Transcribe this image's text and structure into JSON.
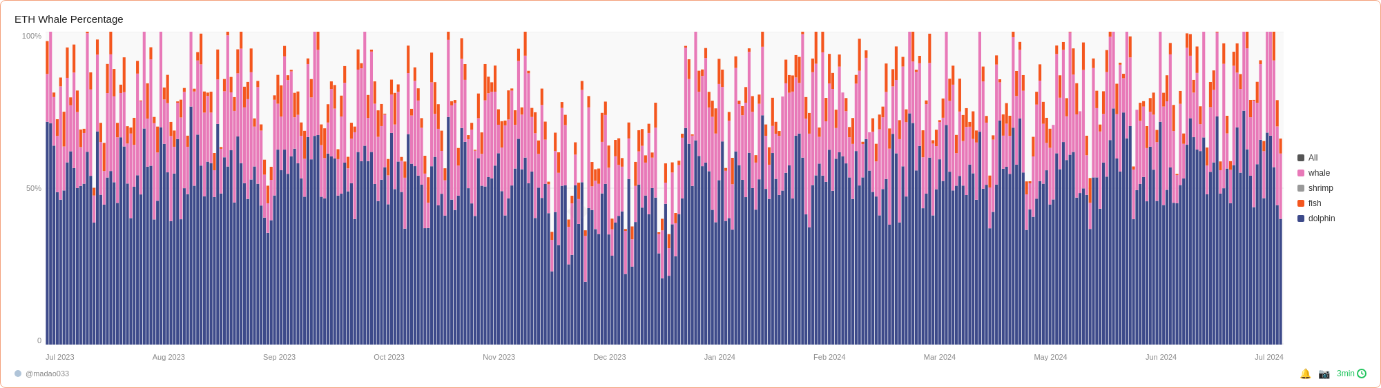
{
  "title": "ETH Whale Percentage",
  "y_axis": {
    "labels": [
      "100%",
      "50%",
      "0"
    ]
  },
  "x_axis": {
    "labels": [
      "Jul 2023",
      "Aug 2023",
      "Sep 2023",
      "Oct 2023",
      "Nov 2023",
      "Dec 2023",
      "Jan 2024",
      "Feb 2024",
      "Mar 2024",
      "May 2024",
      "Jun 2024",
      "Jul 2024"
    ]
  },
  "legend": [
    {
      "label": "All",
      "color": "#555555"
    },
    {
      "label": "whale",
      "color": "#e879b8"
    },
    {
      "label": "shrimp",
      "color": "#999999"
    },
    {
      "label": "fish",
      "color": "#f4561e"
    },
    {
      "label": "dolphin",
      "color": "#3d4a8a"
    }
  ],
  "footer": {
    "username": "@madao033",
    "timer": "3min",
    "username_dot_color": "#b0c4d8"
  },
  "chart": {
    "colors": {
      "dolphin": "#3d4a8a",
      "whale": "#e879b8",
      "fish": "#f4561e",
      "background": "#f9f9f9"
    }
  }
}
